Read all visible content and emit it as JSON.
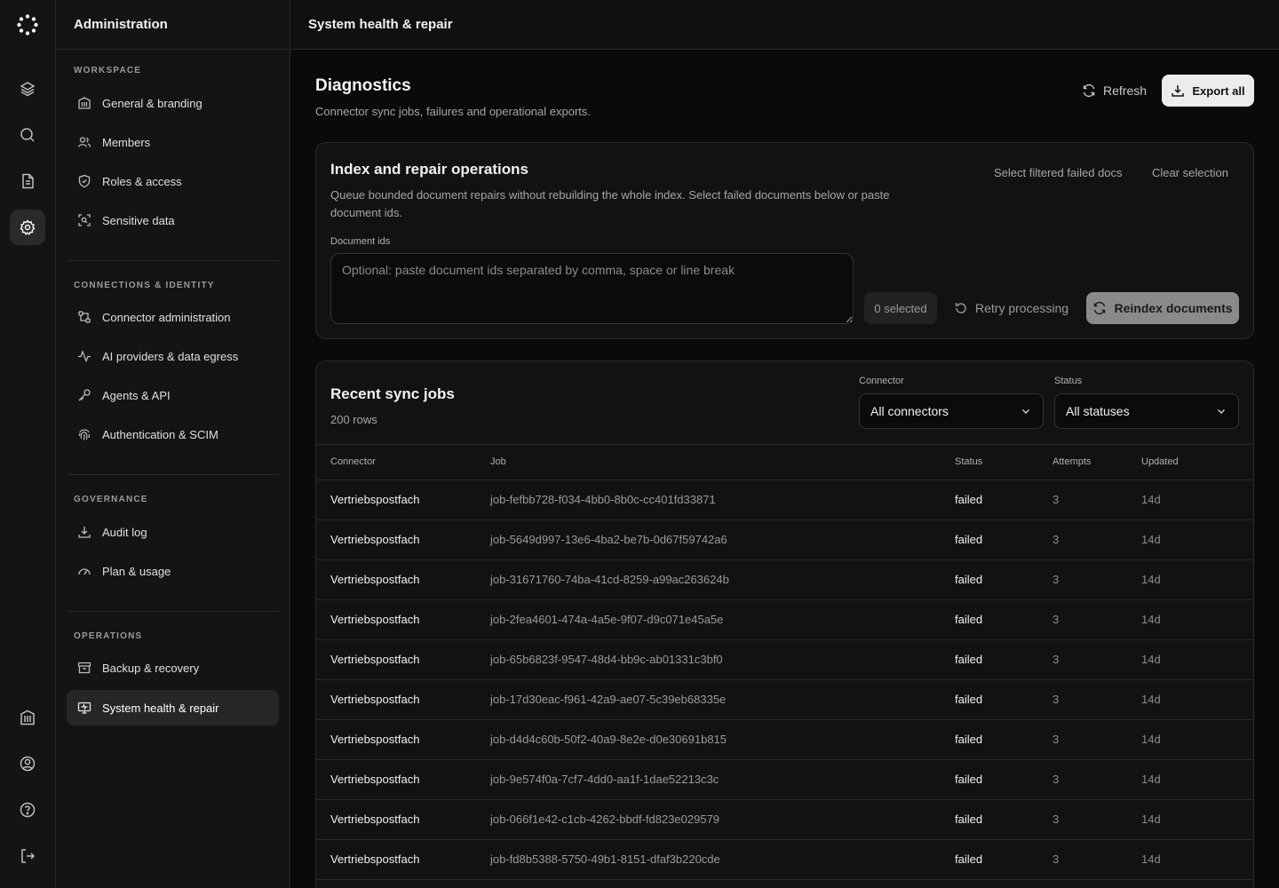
{
  "sidebar": {
    "title": "Administration",
    "sections": [
      {
        "label": "WORKSPACE",
        "items": [
          {
            "label": "General & branding",
            "icon": "building-icon"
          },
          {
            "label": "Members",
            "icon": "users-icon"
          },
          {
            "label": "Roles & access",
            "icon": "shield-icon"
          },
          {
            "label": "Sensitive data",
            "icon": "scan-icon"
          }
        ]
      },
      {
        "label": "CONNECTIONS & IDENTITY",
        "items": [
          {
            "label": "Connector administration",
            "icon": "connector-icon"
          },
          {
            "label": "AI providers & data egress",
            "icon": "activity-icon"
          },
          {
            "label": "Agents & API",
            "icon": "key-icon"
          },
          {
            "label": "Authentication & SCIM",
            "icon": "fingerprint-icon"
          }
        ]
      },
      {
        "label": "GOVERNANCE",
        "items": [
          {
            "label": "Audit log",
            "icon": "download-icon"
          },
          {
            "label": "Plan & usage",
            "icon": "gauge-icon"
          }
        ]
      },
      {
        "label": "OPERATIONS",
        "items": [
          {
            "label": "Backup & recovery",
            "icon": "archive-icon"
          },
          {
            "label": "System health & repair",
            "icon": "monitor-icon",
            "active": true
          }
        ]
      }
    ]
  },
  "topbar": {
    "title": "System health & repair"
  },
  "header": {
    "title": "Diagnostics",
    "subtitle": "Connector sync jobs, failures and operational exports.",
    "refresh_label": "Refresh",
    "export_label": "Export all"
  },
  "repair": {
    "title": "Index and repair operations",
    "description": "Queue bounded document repairs without rebuilding the whole index. Select failed documents below or paste document ids.",
    "select_filtered_label": "Select filtered failed docs",
    "clear_selection_label": "Clear selection",
    "doc_ids_label": "Document ids",
    "doc_ids_placeholder": "Optional: paste document ids separated by comma, space or line break",
    "doc_ids_value": "",
    "selected_label": "0 selected",
    "retry_label": "Retry processing",
    "reindex_label": "Reindex documents"
  },
  "jobs": {
    "title": "Recent sync jobs",
    "rows_count": "200 rows",
    "connector_filter_label": "Connector",
    "connector_filter_value": "All connectors",
    "status_filter_label": "Status",
    "status_filter_value": "All statuses",
    "columns": [
      "Connector",
      "Job",
      "Status",
      "Attempts",
      "Updated"
    ],
    "rows": [
      {
        "connector": "Vertriebspostfach",
        "job": "job-fefbb728-f034-4bb0-8b0c-cc401fd33871",
        "status": "failed",
        "attempts": "3",
        "updated": "14d"
      },
      {
        "connector": "Vertriebspostfach",
        "job": "job-5649d997-13e6-4ba2-be7b-0d67f59742a6",
        "status": "failed",
        "attempts": "3",
        "updated": "14d"
      },
      {
        "connector": "Vertriebspostfach",
        "job": "job-31671760-74ba-41cd-8259-a99ac263624b",
        "status": "failed",
        "attempts": "3",
        "updated": "14d"
      },
      {
        "connector": "Vertriebspostfach",
        "job": "job-2fea4601-474a-4a5e-9f07-d9c071e45a5e",
        "status": "failed",
        "attempts": "3",
        "updated": "14d"
      },
      {
        "connector": "Vertriebspostfach",
        "job": "job-65b6823f-9547-48d4-bb9c-ab01331c3bf0",
        "status": "failed",
        "attempts": "3",
        "updated": "14d"
      },
      {
        "connector": "Vertriebspostfach",
        "job": "job-17d30eac-f961-42a9-ae07-5c39eb68335e",
        "status": "failed",
        "attempts": "3",
        "updated": "14d"
      },
      {
        "connector": "Vertriebspostfach",
        "job": "job-d4d4c60b-50f2-40a9-8e2e-d0e30691b815",
        "status": "failed",
        "attempts": "3",
        "updated": "14d"
      },
      {
        "connector": "Vertriebspostfach",
        "job": "job-9e574f0a-7cf7-4dd0-aa1f-1dae52213c3c",
        "status": "failed",
        "attempts": "3",
        "updated": "14d"
      },
      {
        "connector": "Vertriebspostfach",
        "job": "job-066f1e42-c1cb-4262-bbdf-fd823e029579",
        "status": "failed",
        "attempts": "3",
        "updated": "14d"
      },
      {
        "connector": "Vertriebspostfach",
        "job": "job-fd8b5388-5750-49b1-8151-dfaf3b220cde",
        "status": "failed",
        "attempts": "3",
        "updated": "14d"
      }
    ]
  },
  "colors": {
    "background": "#0a0a0a",
    "panel": "#141414",
    "accent_button": "#ececec",
    "border": "#2a2a2a"
  }
}
